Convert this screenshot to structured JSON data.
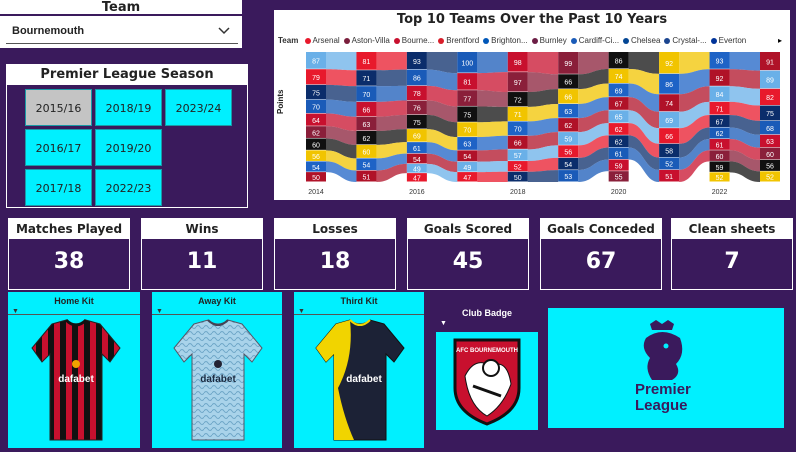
{
  "team_slicer": {
    "title": "Team",
    "selected": "Bournemouth"
  },
  "season_slicer": {
    "title": "Premier League Season",
    "options": [
      "2015/16",
      "2018/19",
      "2023/24",
      "2016/17",
      "2019/20",
      "2017/18",
      "2022/23"
    ],
    "selected": "2015/16"
  },
  "chart": {
    "title": "Top 10 Teams Over the Past 10 Years",
    "legend_label": "Team",
    "legend": [
      {
        "name": "Arsenal",
        "color": "#e8192c"
      },
      {
        "name": "Aston-Villa",
        "color": "#7a1e3c"
      },
      {
        "name": "Bourne...",
        "color": "#c8102e"
      },
      {
        "name": "Brentford",
        "color": "#d81e2a"
      },
      {
        "name": "Brighton...",
        "color": "#0057b8"
      },
      {
        "name": "Burnley",
        "color": "#6c1d45"
      },
      {
        "name": "Cardiff-Ci...",
        "color": "#1a5bb8"
      },
      {
        "name": "Chelsea",
        "color": "#034694"
      },
      {
        "name": "Crystal-...",
        "color": "#1b458f"
      },
      {
        "name": "Everton",
        "color": "#003399"
      }
    ],
    "ylabel": "Points"
  },
  "chart_data": {
    "type": "area",
    "title": "Top 10 Teams Over the Past 10 Years",
    "ylabel": "Points",
    "x_ticks": [
      "2014",
      "2016",
      "2018",
      "2020",
      "2022"
    ],
    "columns": [
      {
        "x": "2014",
        "values": [
          87,
          79,
          75,
          70,
          64,
          62,
          60,
          56,
          54,
          50
        ]
      },
      {
        "x": "2015",
        "values": [
          81,
          71,
          70,
          66,
          63,
          62,
          60,
          54,
          51
        ]
      },
      {
        "x": "2016",
        "values": [
          93,
          86,
          78,
          76,
          75,
          69,
          61,
          54,
          49,
          47
        ]
      },
      {
        "x": "2017",
        "values": [
          100,
          81,
          77,
          75,
          70,
          63,
          54,
          49,
          47
        ]
      },
      {
        "x": "2018",
        "values": [
          98,
          97,
          72,
          71,
          70,
          66,
          57,
          52,
          50
        ]
      },
      {
        "x": "2019",
        "values": [
          99,
          66,
          66,
          63,
          62,
          59,
          56,
          54,
          53
        ]
      },
      {
        "x": "2020",
        "values": [
          86,
          74,
          69,
          67,
          65,
          62,
          62,
          61,
          59,
          55
        ]
      },
      {
        "x": "2021",
        "values": [
          92,
          86,
          74,
          69,
          66,
          58,
          52,
          51
        ]
      },
      {
        "x": "2022",
        "values": [
          93,
          92,
          84,
          71,
          67,
          62,
          61,
          60,
          59,
          52
        ]
      },
      {
        "x": "2023",
        "values": [
          91,
          89,
          82,
          75,
          68,
          63,
          60,
          56,
          52
        ]
      }
    ]
  },
  "kpis": [
    {
      "title": "Matches Played",
      "value": "38"
    },
    {
      "title": "Wins",
      "value": "11"
    },
    {
      "title": "Losses",
      "value": "18"
    },
    {
      "title": "Goals Scored",
      "value": "45"
    },
    {
      "title": "Goals Conceded",
      "value": "67"
    },
    {
      "title": "Clean sheets",
      "value": "7"
    }
  ],
  "kits": {
    "home": "Home Kit",
    "away": "Away Kit",
    "third": "Third Kit",
    "sponsor": "dafabet"
  },
  "badge": {
    "title": "Club Badge",
    "text": "AFC BOURNEMOUTH"
  },
  "league": {
    "line1": "Premier",
    "line2": "League"
  }
}
